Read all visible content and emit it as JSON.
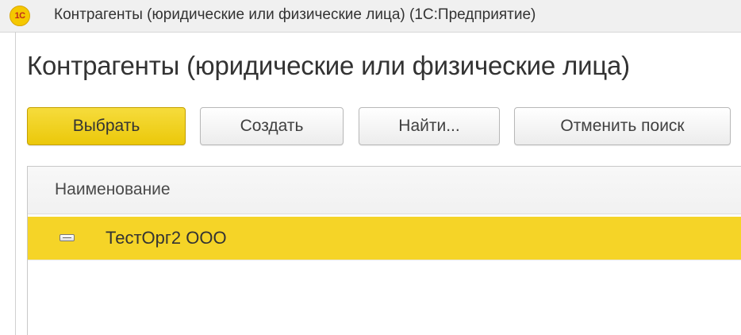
{
  "window": {
    "logo_text": "1С",
    "title": "Контрагенты (юридические или физические лица)  (1С:Предприятие)"
  },
  "page": {
    "title": "Контрагенты (юридические или физические лица)"
  },
  "toolbar": {
    "select_label": "Выбрать",
    "create_label": "Создать",
    "find_label": "Найти...",
    "cancel_search_label": "Отменить поиск"
  },
  "table": {
    "columns": [
      "Наименование"
    ],
    "rows": [
      {
        "name": "ТестОрг2 ООО",
        "selected": true,
        "icon": "element-icon"
      }
    ]
  },
  "colors": {
    "accent": "#f5d427",
    "primary_button": "#ebc80a"
  }
}
